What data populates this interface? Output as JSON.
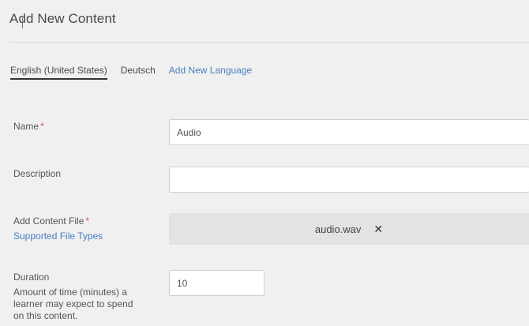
{
  "header": {
    "title": "Add New Content"
  },
  "languages": {
    "tabs": [
      {
        "label": "English (United States)"
      },
      {
        "label": "Deutsch"
      }
    ],
    "add_label": "Add New Language"
  },
  "form": {
    "name": {
      "label": "Name",
      "required_mark": "*",
      "value": "Audio"
    },
    "description": {
      "label": "Description",
      "value": ""
    },
    "content_file": {
      "label": "Add Content File",
      "required_mark": "*",
      "link": "Supported File Types",
      "file_name": "audio.wav",
      "remove_icon": "close-icon"
    },
    "duration": {
      "label": "Duration",
      "help": "Amount of time (minutes) a learner may expect to spend on this content.",
      "value": "10"
    }
  },
  "colors": {
    "link": "#4a7fc0",
    "required": "#d9534f",
    "background": "#f0f0f0"
  }
}
